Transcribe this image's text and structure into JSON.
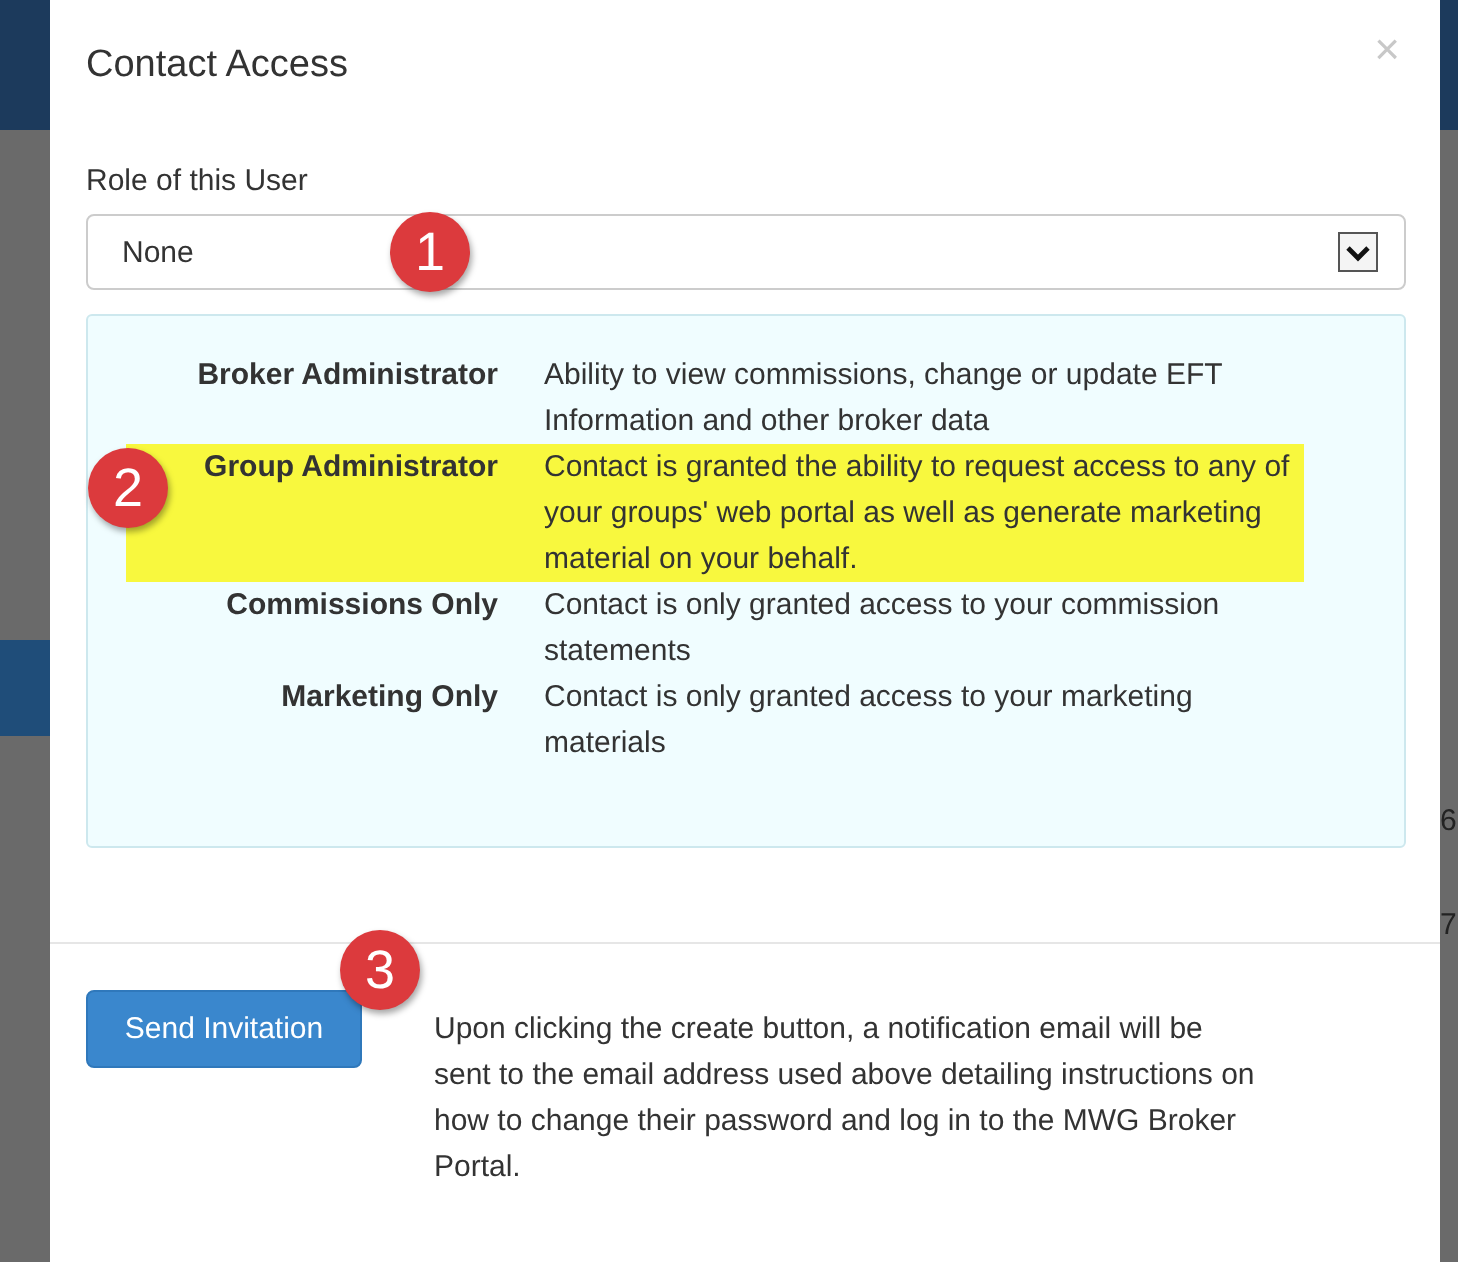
{
  "background": {
    "right_cells": [
      "6",
      "7"
    ]
  },
  "modal": {
    "title": "Contact Access",
    "close": "×",
    "role_field": {
      "label": "Role of this User",
      "value": "None",
      "callout": "1"
    },
    "roles": [
      {
        "name": "Broker Administrator",
        "description": "Ability to view commissions, change or update EFT Information and other broker data",
        "highlighted": false
      },
      {
        "name": "Group Administrator",
        "description": "Contact is granted the ability to request access to any of your groups' web portal as well as generate marketing material on your behalf.",
        "highlighted": true,
        "callout": "2"
      },
      {
        "name": "Commissions Only",
        "description": "Contact is only granted access to your commission statements",
        "highlighted": false
      },
      {
        "name": "Marketing Only",
        "description": "Contact is only granted access to your marketing materials",
        "highlighted": false
      }
    ],
    "footer": {
      "button": "Send Invitation",
      "callout": "3",
      "note": "Upon clicking the create button, a notification email will be sent to the email address used above detailing instructions on how to change their password and log in to the MWG Broker Portal."
    }
  }
}
